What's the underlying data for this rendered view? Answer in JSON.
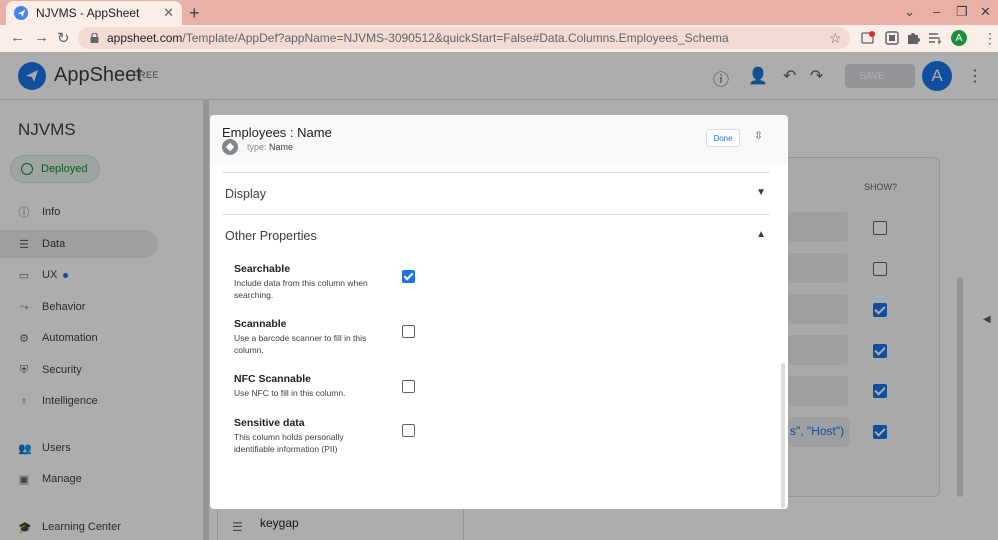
{
  "browser": {
    "tab_title": "NJVMS - AppSheet",
    "url_domain": "appsheet.com",
    "url_path": "/Template/AppDef?appName=NJVMS-3090512&quickStart=False#Data.Columns.Employees_Schema",
    "profile_initial": "A"
  },
  "app": {
    "brand": "AppSheet",
    "plan": "FREE",
    "save_label": "SAVE",
    "user_initial": "A",
    "app_name": "NJVMS",
    "status": "Deployed",
    "nav": [
      {
        "label": "Info",
        "icon": "info-icon"
      },
      {
        "label": "Data",
        "icon": "data-icon"
      },
      {
        "label": "UX",
        "icon": "ux-icon"
      },
      {
        "label": "Behavior",
        "icon": "behavior-icon"
      },
      {
        "label": "Automation",
        "icon": "automation-icon"
      },
      {
        "label": "Security",
        "icon": "security-icon"
      },
      {
        "label": "Intelligence",
        "icon": "intelligence-icon"
      },
      {
        "label": "Users",
        "icon": "users-icon"
      },
      {
        "label": "Manage",
        "icon": "manage-icon"
      },
      {
        "label": "Learning Center",
        "icon": "learning-center-icon"
      }
    ]
  },
  "background": {
    "show_header": "SHOW?",
    "host_text": "s\", \"Host\")",
    "keygap": "keygap"
  },
  "modal": {
    "title": "Employees : Name",
    "type_label": "type:",
    "type_value": "Name",
    "done_label": "Done",
    "sections": {
      "display": "Display",
      "other": "Other Properties"
    },
    "properties": [
      {
        "name": "Searchable",
        "desc": "Include data from this column when searching.",
        "checked": true
      },
      {
        "name": "Scannable",
        "desc": "Use a barcode scanner to fill in this column.",
        "checked": false
      },
      {
        "name": "NFC Scannable",
        "desc": "Use NFC to fill in this column.",
        "checked": false
      },
      {
        "name": "Sensitive data",
        "desc": "This column holds personally identifiable information (PII)",
        "checked": false
      }
    ]
  },
  "colors": {
    "accent": "#1a73e8",
    "tabbar": "#e9b1a5",
    "deployed_green": "#188038"
  }
}
